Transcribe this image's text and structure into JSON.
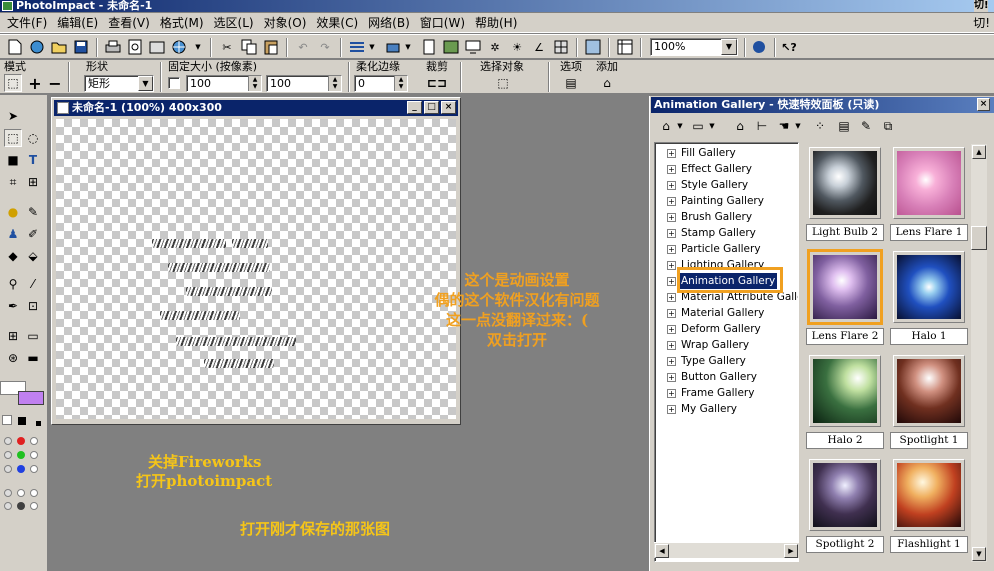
{
  "app": {
    "title": "PhotoImpact - 未命名-1",
    "right_label": "切!"
  },
  "menu": [
    "文件(F)",
    "编辑(E)",
    "查看(V)",
    "格式(M)",
    "选区(L)",
    "对象(O)",
    "效果(C)",
    "网络(B)",
    "窗口(W)",
    "帮助(H)"
  ],
  "toolbar": {
    "zoom_value": "100%"
  },
  "options_bar": {
    "mode_label": "模式",
    "shape_label": "形状",
    "shape_value": "矩形",
    "fixed_size_label": "固定大小 (按像素)",
    "width_value": "100",
    "height_value": "100",
    "feather_label": "柔化边缘",
    "feather_value": "0",
    "crop_label": "裁剪",
    "select_object_label": "选择对象",
    "options_label": "选项",
    "add_label": "添加"
  },
  "document": {
    "title": "未命名-1 (100%) 400x300"
  },
  "annotations": {
    "close_fireworks": "关掉Fireworks",
    "open_photoimpact": "打开photoimpact",
    "open_saved": "打开刚才保存的那张图",
    "anim_line1": "这个是动画设置",
    "anim_line2": "偶的这个软件汉化有问题",
    "anim_line3": "这一点没翻译过来：(",
    "anim_line4": "双击打开"
  },
  "panel": {
    "title": "Animation Gallery - 快速特效面板 (只读)",
    "tree_items": [
      "Fill Gallery",
      "Effect Gallery",
      "Style Gallery",
      "Painting Gallery",
      "Brush Gallery",
      "Stamp Gallery",
      "Particle Gallery",
      "Lighting Gallery",
      "Animation Gallery",
      "Material Attribute Galler",
      "Material Gallery",
      "Deform Gallery",
      "Wrap Gallery",
      "Type Gallery",
      "Button Gallery",
      "Frame Gallery",
      "My Gallery"
    ],
    "selected_item": "Animation Gallery",
    "thumbnails": [
      {
        "label": "Light Bulb 2"
      },
      {
        "label": "Lens Flare 1"
      },
      {
        "label": "Lens Flare 2",
        "selected": true
      },
      {
        "label": "Halo 1"
      },
      {
        "label": "Halo 2"
      },
      {
        "label": "Spotlight 1"
      },
      {
        "label": "Spotlight 2"
      },
      {
        "label": "Flashlight 1"
      }
    ]
  },
  "colors": {
    "annotation_yellow": "#f5c518",
    "annotation_orange": "#f0a020",
    "highlight_border": "#f0a020",
    "title_blue": "#0a246a",
    "secondary_color_swatch": "#c080f0"
  }
}
